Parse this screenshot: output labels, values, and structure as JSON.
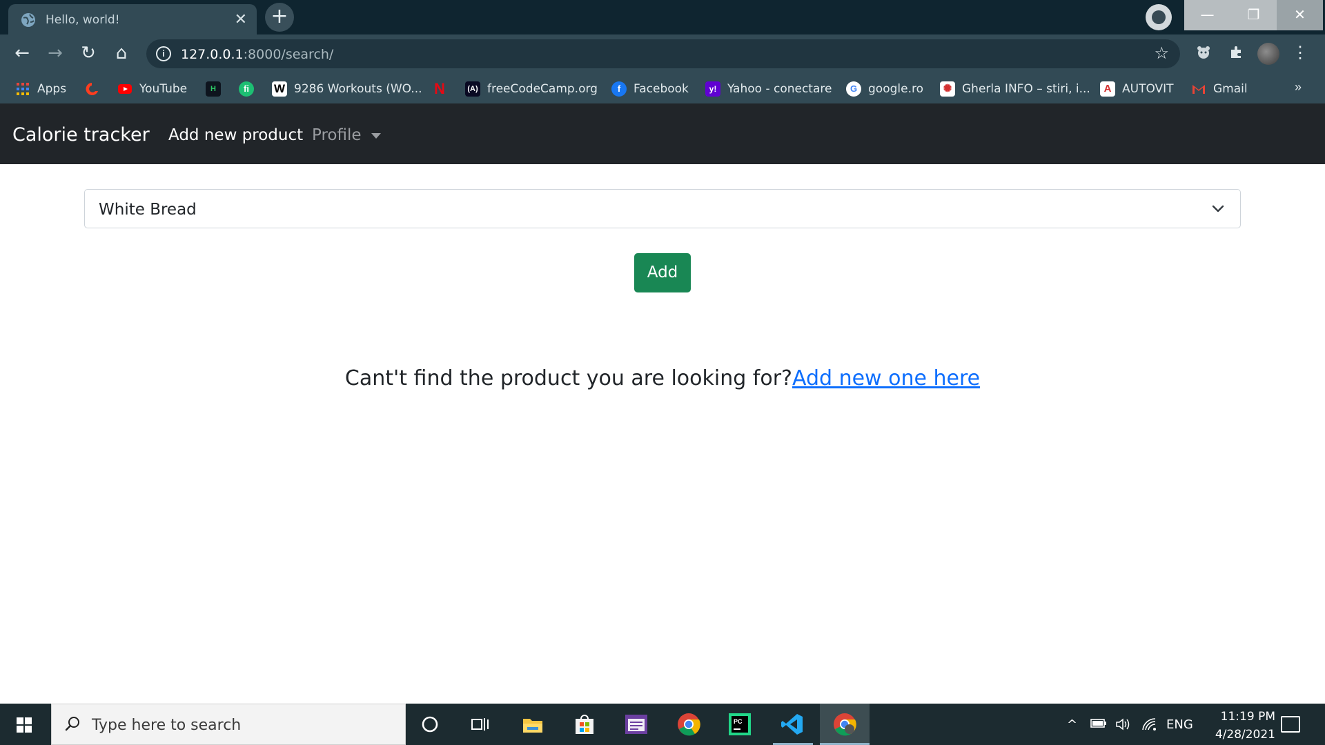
{
  "browser": {
    "tab_title": "Hello, world!",
    "close_glyph": "✕",
    "new_tab_glyph": "+",
    "window_buttons": [
      "—",
      "❐",
      "✕"
    ],
    "url_host": "127.0.0.1",
    "url_path": ":8000/search/",
    "nav": {
      "back": "←",
      "forward": "→",
      "reload": "↻",
      "home": "⌂"
    },
    "bookmarks": [
      {
        "label": "Apps",
        "icon": "apps-grid-icon"
      },
      {
        "label": "",
        "icon": "opera-like-icon"
      },
      {
        "label": "YouTube",
        "icon": "youtube-icon"
      },
      {
        "label": "",
        "icon": "hackerrank-icon"
      },
      {
        "label": "",
        "icon": "fiverr-icon"
      },
      {
        "label": "9286 Workouts (WO...",
        "icon": "w-icon"
      },
      {
        "label": "",
        "icon": "netflix-icon"
      },
      {
        "label": "freeCodeCamp.org",
        "icon": "freecodecamp-icon"
      },
      {
        "label": "Facebook",
        "icon": "facebook-icon"
      },
      {
        "label": "Yahoo - conectare",
        "icon": "yahoo-icon"
      },
      {
        "label": "google.ro",
        "icon": "google-icon"
      },
      {
        "label": "Gherla INFO – stiri, i...",
        "icon": "gherla-info-icon"
      },
      {
        "label": "AUTOVIT",
        "icon": "autovit-icon"
      },
      {
        "label": "Gmail",
        "icon": "gmail-icon"
      }
    ],
    "more_bookmarks": "»"
  },
  "site": {
    "brand": "Calorie tracker",
    "nav_add": "Add new product",
    "nav_profile": "Profile",
    "product_selected": "White Bread",
    "add_button": "Add",
    "helper_text": "Cant't find the product you are looking for?",
    "helper_link": "Add new one here",
    "colors": {
      "navbar": "#212529",
      "success": "#198754",
      "link": "#0d6efd"
    }
  },
  "taskbar": {
    "search_placeholder": "Type here to search",
    "language": "ENG",
    "time": "11:19 PM",
    "date": "4/28/2021",
    "apps": [
      "cortana-icon",
      "task-view-icon",
      "file-explorer-icon",
      "store-icon",
      "calendar-app-icon",
      "chrome-icon",
      "pycharm-icon",
      "vscode-icon",
      "chrome-active-icon"
    ]
  }
}
